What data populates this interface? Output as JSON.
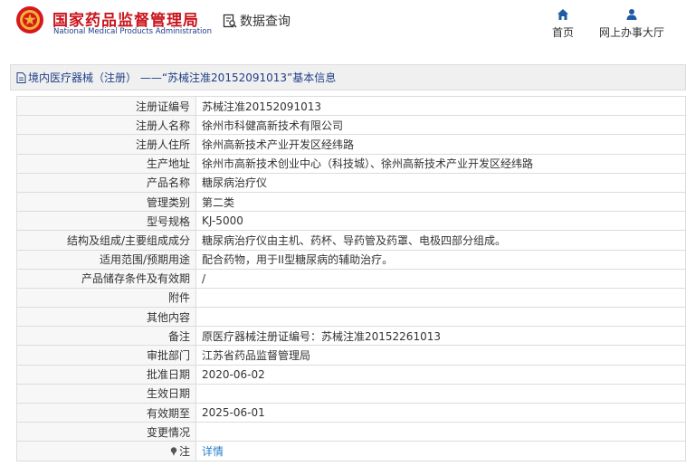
{
  "header": {
    "site_cn": "国家药品监督管理局",
    "site_en": "National Medical Products Administration",
    "query_label": "数据查询",
    "nav": [
      {
        "label": "首页",
        "icon": "home-icon"
      },
      {
        "label": "网上办事大厅",
        "icon": "user-icon"
      }
    ]
  },
  "breadcrumb": {
    "prefix": "境内医疗器械（注册） ——",
    "title": "“苏械注准20152091013”基本信息"
  },
  "rows": [
    {
      "label": "注册证编号",
      "value": "苏械注准20152091013"
    },
    {
      "label": "注册人名称",
      "value": "徐州市科健高新技术有限公司"
    },
    {
      "label": "注册人住所",
      "value": "徐州高新技术产业开发区经纬路"
    },
    {
      "label": "生产地址",
      "value": "徐州市高新技术创业中心（科技城）、徐州高新技术产业开发区经纬路"
    },
    {
      "label": "产品名称",
      "value": "糖尿病治疗仪"
    },
    {
      "label": "管理类别",
      "value": "第二类"
    },
    {
      "label": "型号规格",
      "value": "KJ-5000"
    },
    {
      "label": "结构及组成/主要组成成分",
      "value": "糖尿病治疗仪由主机、药杯、导药管及药罩、电极四部分组成。"
    },
    {
      "label": "适用范围/预期用途",
      "value": "配合药物，用于II型糖尿病的辅助治疗。"
    },
    {
      "label": "产品储存条件及有效期",
      "value": "/"
    },
    {
      "label": "附件",
      "value": ""
    },
    {
      "label": "其他内容",
      "value": ""
    },
    {
      "label": "备注",
      "value": "原医疗器械注册证编号：苏械注准20152261013"
    },
    {
      "label": "审批部门",
      "value": "江苏省药品监督管理局"
    },
    {
      "label": "批准日期",
      "value": "2020-06-02"
    },
    {
      "label": "生效日期",
      "value": ""
    },
    {
      "label": "有效期至",
      "value": "2025-06-01"
    },
    {
      "label": "变更情况",
      "value": ""
    }
  ],
  "note_row": {
    "label": "注",
    "icon": "pin-icon",
    "link": "详情"
  },
  "colors": {
    "brand_red": "#c8161d",
    "brand_blue": "#1f3f86",
    "link": "#2a7fc9"
  }
}
